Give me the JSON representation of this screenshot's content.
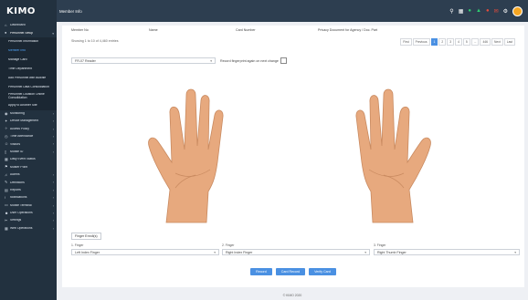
{
  "app": {
    "brand": "KIMO"
  },
  "topbar": {
    "title": "Member Info"
  },
  "sidebar": {
    "items": [
      {
        "label": "Dashboard",
        "icon": "home-icon"
      },
      {
        "label": "Personnel Setup",
        "icon": "user-icon",
        "expanded": true
      },
      {
        "label": "Monitoring",
        "icon": "eye-icon"
      },
      {
        "label": "Device Management",
        "icon": "gear-icon"
      },
      {
        "label": "Access Policy",
        "icon": "key-icon"
      },
      {
        "label": "Time Attendance",
        "icon": "clock-icon"
      },
      {
        "label": "Visitors",
        "icon": "visitor-icon"
      },
      {
        "label": "Mobile ID",
        "icon": "phone-icon"
      },
      {
        "label": "Daily Event Status",
        "icon": "calendar-icon"
      },
      {
        "label": "Muster Point",
        "icon": "flag-icon"
      },
      {
        "label": "Alarms",
        "icon": "bell-icon"
      },
      {
        "label": "Definitions",
        "icon": "pencil-icon"
      },
      {
        "label": "Reports",
        "icon": "report-icon"
      },
      {
        "label": "Notifications",
        "icon": "alert-icon"
      },
      {
        "label": "Mobile Terminal",
        "icon": "mobile-icon"
      },
      {
        "label": "User Operations",
        "icon": "users-icon"
      },
      {
        "label": "Settings",
        "icon": "wrench-icon"
      },
      {
        "label": "Web Operations",
        "icon": "grid-icon"
      }
    ],
    "subitems": [
      {
        "label": "Personnel Information"
      },
      {
        "label": "Member Info",
        "current": true
      },
      {
        "label": "Manage Card"
      },
      {
        "label": "Time Department"
      },
      {
        "label": "Add Personnel with Bulkfile"
      },
      {
        "label": "Personnel Data Consolidation"
      },
      {
        "label": "Personnel Location Online Consolidation"
      },
      {
        "label": "Apply to Another Site"
      }
    ]
  },
  "table": {
    "columns": [
      "Member No",
      "Name",
      "Card Number",
      "Privacy Document for Agency / Doc. Part"
    ],
    "showing": "Showing 1 to 10 of 4,460 entries"
  },
  "pagination": [
    "First",
    "Previous",
    "1",
    "2",
    "3",
    "4",
    "5",
    "...",
    "446",
    "Next",
    "Last"
  ],
  "pagination_active": "1",
  "enroll": {
    "device_select": "FR-07 Reader",
    "checkbox_label": "Record fingerprint again on next change"
  },
  "hands": {
    "skin": "#e7a97e",
    "skin_shade": "#c98a60"
  },
  "fingers": {
    "button": "Finger Enroll(s)",
    "labels": [
      "1. Finger",
      "2. Finger",
      "3. Finger"
    ],
    "values": [
      "Left Index Finger",
      "Right Index Finger",
      "Right Thumb Finger"
    ]
  },
  "actions": {
    "record": "Record",
    "card_record": "Card Record",
    "verify": "Verify Card"
  },
  "footer": {
    "text": "© KIMO 2020"
  },
  "colors": {
    "sidebar": "#22313f",
    "topbar": "#2d3e50",
    "accent": "#4a90e2"
  }
}
